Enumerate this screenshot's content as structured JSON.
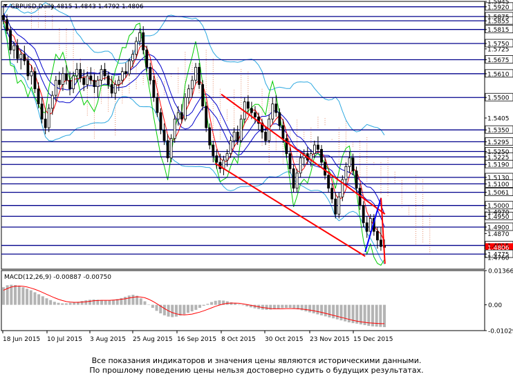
{
  "chart_data": [
    {
      "type": "candlestick",
      "header": {
        "symbol": "GBPUSD,Daily",
        "ohlc": "1.4815 1.4843 1.4792 1.4806"
      },
      "x_labels": [
        "18 Jun 2015",
        "10 Jul 2015",
        "3 Aug 2015",
        "25 Aug 2015",
        "16 Sep 2015",
        "8 Oct 2015",
        "30 Oct 2015",
        "23 Nov 2015",
        "15 Dec 2015"
      ],
      "ylim": [
        1.4705,
        1.5945
      ],
      "y_tick_labels": [
        "1.5945",
        "1.5920",
        "1.5875",
        "1.5855",
        "1.5815",
        "1.5750",
        "1.5725",
        "1.5675",
        "1.5610",
        "1.5500",
        "1.5405",
        "1.5350",
        "1.5295",
        "1.5250",
        "1.5225",
        "1.5190",
        "1.5130",
        "1.5100",
        "1.5061",
        "1.5000",
        "1.4970",
        "1.4950",
        "1.4900",
        "1.4870",
        "1.4815",
        "1.4806",
        "1.4775",
        "1.4760"
      ],
      "levels": [
        {
          "value": 1.592,
          "label": "1.5920"
        },
        {
          "value": 1.5875,
          "label": "1.5875"
        },
        {
          "value": 1.5855,
          "label": "1.5855"
        },
        {
          "value": 1.5815,
          "label": "1.5815"
        },
        {
          "value": 1.575,
          "label": "1.5750"
        },
        {
          "value": 1.5675,
          "label": "1.5675"
        },
        {
          "value": 1.561,
          "label": "1.5610"
        },
        {
          "value": 1.55,
          "label": "1.5500"
        },
        {
          "value": 1.535,
          "label": "1.5350"
        },
        {
          "value": 1.5295,
          "label": "1.5295"
        },
        {
          "value": 1.525,
          "label": "1.5250"
        },
        {
          "value": 1.5225,
          "label": "1.5225"
        },
        {
          "value": 1.519,
          "label": "1.5190"
        },
        {
          "value": 1.513,
          "label": "1.5130"
        },
        {
          "value": 1.51,
          "label": "1.5100"
        },
        {
          "value": 1.5061,
          "label": "1.5061"
        },
        {
          "value": 1.5,
          "label": "1.5000"
        },
        {
          "value": 1.495,
          "label": "1.4950"
        },
        {
          "value": 1.49,
          "label": "1.4900"
        },
        {
          "value": 1.4815,
          "label": "1.4815"
        },
        {
          "value": 1.4775,
          "label": "1.4775"
        }
      ],
      "current_price": {
        "value": 1.4806,
        "label": "1.4806"
      },
      "channel": {
        "upper": [
          {
            "date": "2015-10-08",
            "price": 1.5515
          },
          {
            "date": "2015-12-31",
            "price": 1.496
          }
        ],
        "lower": [
          {
            "date": "2015-10-05",
            "price": 1.5195
          },
          {
            "date": "2015-12-21",
            "price": 1.4765
          }
        ]
      },
      "forecast": {
        "up": [
          {
            "date": "2015-12-21",
            "price": 1.4785
          },
          {
            "date": "2015-12-29",
            "price": 1.5035
          }
        ],
        "down": [
          {
            "date": "2015-12-29",
            "price": 1.5035
          },
          {
            "date": "2015-12-31",
            "price": 1.473
          }
        ]
      },
      "colors": {
        "levels": "#00008b",
        "channel": "#ff0000",
        "forecast_up": "#0000ff",
        "forecast_down": "#ff0000",
        "bollinger": "#2aa7e0",
        "envelope": "#0000cc",
        "ma_fast": "#ff0000",
        "ma_slow": "#00cc00",
        "ichimoku_cloud": "#e07b54",
        "current_price_bg": "#ff0000"
      },
      "candles": [
        {
          "o": 1.588,
          "h": 1.593,
          "l": 1.584,
          "c": 1.586
        },
        {
          "o": 1.586,
          "h": 1.5885,
          "l": 1.5795,
          "c": 1.581
        },
        {
          "o": 1.581,
          "h": 1.583,
          "l": 1.57,
          "c": 1.572
        },
        {
          "o": 1.572,
          "h": 1.576,
          "l": 1.568,
          "c": 1.574
        },
        {
          "o": 1.574,
          "h": 1.577,
          "l": 1.566,
          "c": 1.568
        },
        {
          "o": 1.568,
          "h": 1.572,
          "l": 1.563,
          "c": 1.57
        },
        {
          "o": 1.57,
          "h": 1.574,
          "l": 1.565,
          "c": 1.567
        },
        {
          "o": 1.567,
          "h": 1.569,
          "l": 1.558,
          "c": 1.56
        },
        {
          "o": 1.56,
          "h": 1.565,
          "l": 1.556,
          "c": 1.562
        },
        {
          "o": 1.562,
          "h": 1.564,
          "l": 1.552,
          "c": 1.554
        },
        {
          "o": 1.554,
          "h": 1.557,
          "l": 1.545,
          "c": 1.547
        },
        {
          "o": 1.547,
          "h": 1.55,
          "l": 1.538,
          "c": 1.54
        },
        {
          "o": 1.54,
          "h": 1.544,
          "l": 1.533,
          "c": 1.536
        },
        {
          "o": 1.536,
          "h": 1.547,
          "l": 1.534,
          "c": 1.545
        },
        {
          "o": 1.545,
          "h": 1.553,
          "l": 1.542,
          "c": 1.551
        },
        {
          "o": 1.551,
          "h": 1.56,
          "l": 1.548,
          "c": 1.558
        },
        {
          "o": 1.558,
          "h": 1.562,
          "l": 1.554,
          "c": 1.556
        },
        {
          "o": 1.556,
          "h": 1.564,
          "l": 1.553,
          "c": 1.561
        },
        {
          "o": 1.561,
          "h": 1.565,
          "l": 1.556,
          "c": 1.558
        },
        {
          "o": 1.558,
          "h": 1.562,
          "l": 1.551,
          "c": 1.554
        },
        {
          "o": 1.554,
          "h": 1.562,
          "l": 1.552,
          "c": 1.56
        },
        {
          "o": 1.56,
          "h": 1.566,
          "l": 1.557,
          "c": 1.563
        },
        {
          "o": 1.563,
          "h": 1.566,
          "l": 1.557,
          "c": 1.559
        },
        {
          "o": 1.559,
          "h": 1.563,
          "l": 1.553,
          "c": 1.556
        },
        {
          "o": 1.556,
          "h": 1.562,
          "l": 1.554,
          "c": 1.56
        },
        {
          "o": 1.56,
          "h": 1.564,
          "l": 1.556,
          "c": 1.558
        },
        {
          "o": 1.558,
          "h": 1.561,
          "l": 1.552,
          "c": 1.555
        },
        {
          "o": 1.555,
          "h": 1.56,
          "l": 1.55,
          "c": 1.558
        },
        {
          "o": 1.558,
          "h": 1.565,
          "l": 1.556,
          "c": 1.563
        },
        {
          "o": 1.563,
          "h": 1.566,
          "l": 1.558,
          "c": 1.56
        },
        {
          "o": 1.56,
          "h": 1.562,
          "l": 1.554,
          "c": 1.556
        },
        {
          "o": 1.556,
          "h": 1.56,
          "l": 1.55,
          "c": 1.552
        },
        {
          "o": 1.552,
          "h": 1.558,
          "l": 1.549,
          "c": 1.556
        },
        {
          "o": 1.556,
          "h": 1.56,
          "l": 1.553,
          "c": 1.558
        },
        {
          "o": 1.558,
          "h": 1.564,
          "l": 1.556,
          "c": 1.562
        },
        {
          "o": 1.562,
          "h": 1.566,
          "l": 1.559,
          "c": 1.561
        },
        {
          "o": 1.561,
          "h": 1.568,
          "l": 1.56,
          "c": 1.567
        },
        {
          "o": 1.567,
          "h": 1.572,
          "l": 1.564,
          "c": 1.57
        },
        {
          "o": 1.57,
          "h": 1.578,
          "l": 1.568,
          "c": 1.576
        },
        {
          "o": 1.576,
          "h": 1.582,
          "l": 1.574,
          "c": 1.58
        },
        {
          "o": 1.58,
          "h": 1.583,
          "l": 1.57,
          "c": 1.572
        },
        {
          "o": 1.572,
          "h": 1.574,
          "l": 1.562,
          "c": 1.564
        },
        {
          "o": 1.564,
          "h": 1.566,
          "l": 1.556,
          "c": 1.558
        },
        {
          "o": 1.558,
          "h": 1.56,
          "l": 1.548,
          "c": 1.55
        },
        {
          "o": 1.55,
          "h": 1.552,
          "l": 1.541,
          "c": 1.543
        },
        {
          "o": 1.543,
          "h": 1.545,
          "l": 1.533,
          "c": 1.535
        },
        {
          "o": 1.535,
          "h": 1.538,
          "l": 1.528,
          "c": 1.53
        },
        {
          "o": 1.53,
          "h": 1.533,
          "l": 1.52,
          "c": 1.522
        },
        {
          "o": 1.522,
          "h": 1.533,
          "l": 1.52,
          "c": 1.531
        },
        {
          "o": 1.531,
          "h": 1.542,
          "l": 1.529,
          "c": 1.54
        },
        {
          "o": 1.54,
          "h": 1.546,
          "l": 1.537,
          "c": 1.543
        },
        {
          "o": 1.543,
          "h": 1.547,
          "l": 1.538,
          "c": 1.54
        },
        {
          "o": 1.54,
          "h": 1.552,
          "l": 1.539,
          "c": 1.55
        },
        {
          "o": 1.55,
          "h": 1.556,
          "l": 1.547,
          "c": 1.554
        },
        {
          "o": 1.554,
          "h": 1.56,
          "l": 1.55,
          "c": 1.558
        },
        {
          "o": 1.558,
          "h": 1.566,
          "l": 1.556,
          "c": 1.564
        },
        {
          "o": 1.564,
          "h": 1.566,
          "l": 1.554,
          "c": 1.556
        },
        {
          "o": 1.556,
          "h": 1.558,
          "l": 1.544,
          "c": 1.546
        },
        {
          "o": 1.546,
          "h": 1.548,
          "l": 1.534,
          "c": 1.536
        },
        {
          "o": 1.536,
          "h": 1.538,
          "l": 1.526,
          "c": 1.528
        },
        {
          "o": 1.528,
          "h": 1.53,
          "l": 1.52,
          "c": 1.523
        },
        {
          "o": 1.523,
          "h": 1.526,
          "l": 1.517,
          "c": 1.52
        },
        {
          "o": 1.52,
          "h": 1.524,
          "l": 1.515,
          "c": 1.517
        },
        {
          "o": 1.517,
          "h": 1.523,
          "l": 1.514,
          "c": 1.521
        },
        {
          "o": 1.521,
          "h": 1.526,
          "l": 1.518,
          "c": 1.524
        },
        {
          "o": 1.524,
          "h": 1.532,
          "l": 1.522,
          "c": 1.53
        },
        {
          "o": 1.53,
          "h": 1.536,
          "l": 1.527,
          "c": 1.534
        },
        {
          "o": 1.534,
          "h": 1.537,
          "l": 1.528,
          "c": 1.53
        },
        {
          "o": 1.53,
          "h": 1.542,
          "l": 1.529,
          "c": 1.54
        },
        {
          "o": 1.54,
          "h": 1.55,
          "l": 1.538,
          "c": 1.548
        },
        {
          "o": 1.548,
          "h": 1.551,
          "l": 1.542,
          "c": 1.545
        },
        {
          "o": 1.545,
          "h": 1.548,
          "l": 1.54,
          "c": 1.543
        },
        {
          "o": 1.543,
          "h": 1.546,
          "l": 1.538,
          "c": 1.541
        },
        {
          "o": 1.541,
          "h": 1.543,
          "l": 1.535,
          "c": 1.538
        },
        {
          "o": 1.538,
          "h": 1.54,
          "l": 1.531,
          "c": 1.534
        },
        {
          "o": 1.534,
          "h": 1.536,
          "l": 1.528,
          "c": 1.53
        },
        {
          "o": 1.53,
          "h": 1.542,
          "l": 1.529,
          "c": 1.54
        },
        {
          "o": 1.54,
          "h": 1.55,
          "l": 1.538,
          "c": 1.547
        },
        {
          "o": 1.547,
          "h": 1.551,
          "l": 1.541,
          "c": 1.543
        },
        {
          "o": 1.543,
          "h": 1.545,
          "l": 1.535,
          "c": 1.537
        },
        {
          "o": 1.537,
          "h": 1.54,
          "l": 1.529,
          "c": 1.531
        },
        {
          "o": 1.531,
          "h": 1.533,
          "l": 1.522,
          "c": 1.524
        },
        {
          "o": 1.524,
          "h": 1.527,
          "l": 1.515,
          "c": 1.517
        },
        {
          "o": 1.517,
          "h": 1.519,
          "l": 1.506,
          "c": 1.508
        },
        {
          "o": 1.508,
          "h": 1.517,
          "l": 1.506,
          "c": 1.515
        },
        {
          "o": 1.515,
          "h": 1.524,
          "l": 1.513,
          "c": 1.522
        },
        {
          "o": 1.522,
          "h": 1.526,
          "l": 1.518,
          "c": 1.524
        },
        {
          "o": 1.524,
          "h": 1.527,
          "l": 1.519,
          "c": 1.521
        },
        {
          "o": 1.521,
          "h": 1.526,
          "l": 1.518,
          "c": 1.524
        },
        {
          "o": 1.524,
          "h": 1.53,
          "l": 1.522,
          "c": 1.528
        },
        {
          "o": 1.528,
          "h": 1.532,
          "l": 1.524,
          "c": 1.526
        },
        {
          "o": 1.526,
          "h": 1.528,
          "l": 1.518,
          "c": 1.52
        },
        {
          "o": 1.52,
          "h": 1.522,
          "l": 1.512,
          "c": 1.514
        },
        {
          "o": 1.514,
          "h": 1.516,
          "l": 1.506,
          "c": 1.508
        },
        {
          "o": 1.508,
          "h": 1.51,
          "l": 1.501,
          "c": 1.503
        },
        {
          "o": 1.503,
          "h": 1.506,
          "l": 1.494,
          "c": 1.496
        },
        {
          "o": 1.496,
          "h": 1.506,
          "l": 1.494,
          "c": 1.504
        },
        {
          "o": 1.504,
          "h": 1.514,
          "l": 1.502,
          "c": 1.512
        },
        {
          "o": 1.512,
          "h": 1.52,
          "l": 1.509,
          "c": 1.518
        },
        {
          "o": 1.518,
          "h": 1.525,
          "l": 1.515,
          "c": 1.522
        },
        {
          "o": 1.522,
          "h": 1.524,
          "l": 1.514,
          "c": 1.516
        },
        {
          "o": 1.516,
          "h": 1.518,
          "l": 1.506,
          "c": 1.508
        },
        {
          "o": 1.508,
          "h": 1.51,
          "l": 1.498,
          "c": 1.5
        },
        {
          "o": 1.5,
          "h": 1.502,
          "l": 1.49,
          "c": 1.492
        },
        {
          "o": 1.492,
          "h": 1.495,
          "l": 1.485,
          "c": 1.488
        },
        {
          "o": 1.488,
          "h": 1.496,
          "l": 1.486,
          "c": 1.494
        },
        {
          "o": 1.494,
          "h": 1.496,
          "l": 1.486,
          "c": 1.488
        },
        {
          "o": 1.488,
          "h": 1.49,
          "l": 1.48,
          "c": 1.484
        },
        {
          "o": 1.484,
          "h": 1.49,
          "l": 1.479,
          "c": 1.481
        },
        {
          "o": 1.4815,
          "h": 1.4843,
          "l": 1.4792,
          "c": 1.4806
        }
      ]
    },
    {
      "type": "histogram",
      "label": "MACD(12,26,9) -0.00887 -0.00750",
      "ylim": [
        -0.01029,
        0.01366
      ],
      "y_tick_labels": [
        "0.01366",
        "0.00",
        "-0.01029"
      ],
      "histogram": [
        0.007,
        0.0078,
        0.008,
        0.0079,
        0.0075,
        0.007,
        0.0064,
        0.0058,
        0.005,
        0.0042,
        0.0034,
        0.0026,
        0.0019,
        0.0012,
        0.0008,
        0.0006,
        0.0006,
        0.0008,
        0.001,
        0.0012,
        0.0015,
        0.0018,
        0.002,
        0.0021,
        0.002,
        0.0019,
        0.0018,
        0.0018,
        0.002,
        0.0023,
        0.0027,
        0.0032,
        0.0037,
        0.004,
        0.0036,
        0.0026,
        0.0014,
        0.0001,
        -0.0012,
        -0.0024,
        -0.0034,
        -0.0042,
        -0.0047,
        -0.0049,
        -0.0047,
        -0.0043,
        -0.0038,
        -0.0032,
        -0.0026,
        -0.002,
        -0.0012,
        -0.0004,
        0.0004,
        0.0011,
        0.0016,
        0.0018,
        0.0017,
        0.0014,
        0.001,
        0.0006,
        0.0002,
        -0.0002,
        -0.0006,
        -0.001,
        -0.0014,
        -0.0017,
        -0.0019,
        -0.002,
        -0.0019,
        -0.0017,
        -0.0015,
        -0.0013,
        -0.0012,
        -0.0012,
        -0.0014,
        -0.0018,
        -0.0022,
        -0.0026,
        -0.003,
        -0.0034,
        -0.0038,
        -0.0042,
        -0.0046,
        -0.005,
        -0.0054,
        -0.0058,
        -0.0062,
        -0.0066,
        -0.007,
        -0.0073,
        -0.0075,
        -0.0078,
        -0.0081,
        -0.0084,
        -0.0086,
        -0.0087,
        -0.0088,
        -0.0089
      ],
      "signal": [
        0.0058,
        0.0065,
        0.0071,
        0.0074,
        0.0075,
        0.0074,
        0.0071,
        0.0067,
        0.0062,
        0.0056,
        0.0049,
        0.0042,
        0.0035,
        0.0028,
        0.0022,
        0.0017,
        0.0013,
        0.0011,
        0.001,
        0.001,
        0.0011,
        0.0012,
        0.0014,
        0.0016,
        0.0017,
        0.0018,
        0.0018,
        0.0018,
        0.0019,
        0.002,
        0.0022,
        0.0024,
        0.0027,
        0.003,
        0.0032,
        0.0031,
        0.0028,
        0.0022,
        0.0014,
        0.0005,
        -0.0005,
        -0.0015,
        -0.0024,
        -0.0031,
        -0.0036,
        -0.0039,
        -0.004,
        -0.0039,
        -0.0037,
        -0.0033,
        -0.0029,
        -0.0024,
        -0.0018,
        -0.0012,
        -0.0006,
        -0.0001,
        0.0003,
        0.0006,
        0.0007,
        0.0007,
        0.0006,
        0.0004,
        0.0001,
        -0.0002,
        -0.0005,
        -0.0008,
        -0.0011,
        -0.0013,
        -0.0015,
        -0.0016,
        -0.0016,
        -0.0016,
        -0.0015,
        -0.0015,
        -0.0015,
        -0.0016,
        -0.0017,
        -0.0019,
        -0.0021,
        -0.0024,
        -0.0027,
        -0.003,
        -0.0034,
        -0.0038,
        -0.0042,
        -0.0046,
        -0.005,
        -0.0054,
        -0.0058,
        -0.0062,
        -0.0065,
        -0.0068,
        -0.007,
        -0.0072,
        -0.0073,
        -0.0074,
        -0.0075,
        -0.0075
      ],
      "colors": {
        "histogram": "#b4b4b4",
        "signal": "#ff0000"
      }
    }
  ],
  "disclaimer": {
    "line1": "Все показания индикаторов и значения цены являются историческими данными.",
    "line2": "По прошлому поведению цены нельзя достоверно судить о будущих результатах."
  }
}
